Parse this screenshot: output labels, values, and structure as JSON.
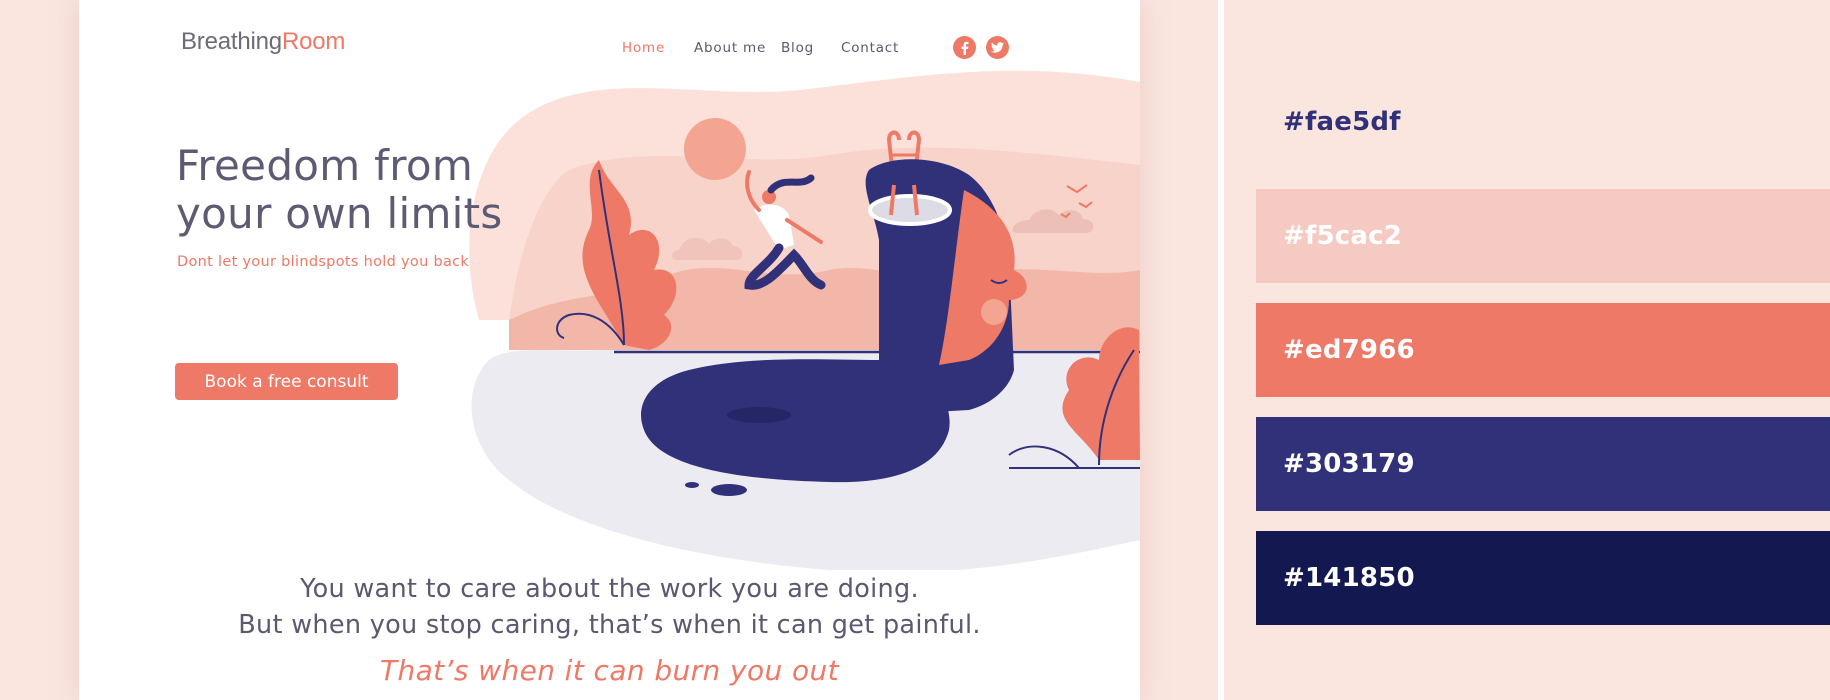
{
  "site": {
    "logo": {
      "part1": "Breathing",
      "part2": "Room"
    },
    "nav": [
      {
        "label": "Home",
        "active": true
      },
      {
        "label": "About me",
        "active": false
      },
      {
        "label": "Blog",
        "active": false
      },
      {
        "label": "Contact",
        "active": false
      }
    ],
    "social": [
      {
        "icon": "facebook-icon"
      },
      {
        "icon": "twitter-icon"
      }
    ],
    "hero": {
      "title": "Freedom from your own limits",
      "subtitle": "Dont let your blindspots hold you back",
      "cta_label": "Book a free consult"
    },
    "body": {
      "line1": "You want to care about the work you are doing.",
      "line2": "But when you stop caring, that’s when it can get painful.",
      "emphasis": "That’s when it can burn you out"
    }
  },
  "palette": [
    {
      "label": "#fae5df",
      "color": "#fae5df",
      "text_color": "#303179"
    },
    {
      "label": "#f5cac2",
      "color": "#f5cac2",
      "text_color": "#ffffff"
    },
    {
      "label": "#ed7966",
      "color": "#ed7966",
      "text_color": "#ffffff"
    },
    {
      "label": "#303179",
      "color": "#303179",
      "text_color": "#ffffff"
    },
    {
      "label": "#141850",
      "color": "#141850",
      "text_color": "#ffffff"
    }
  ]
}
